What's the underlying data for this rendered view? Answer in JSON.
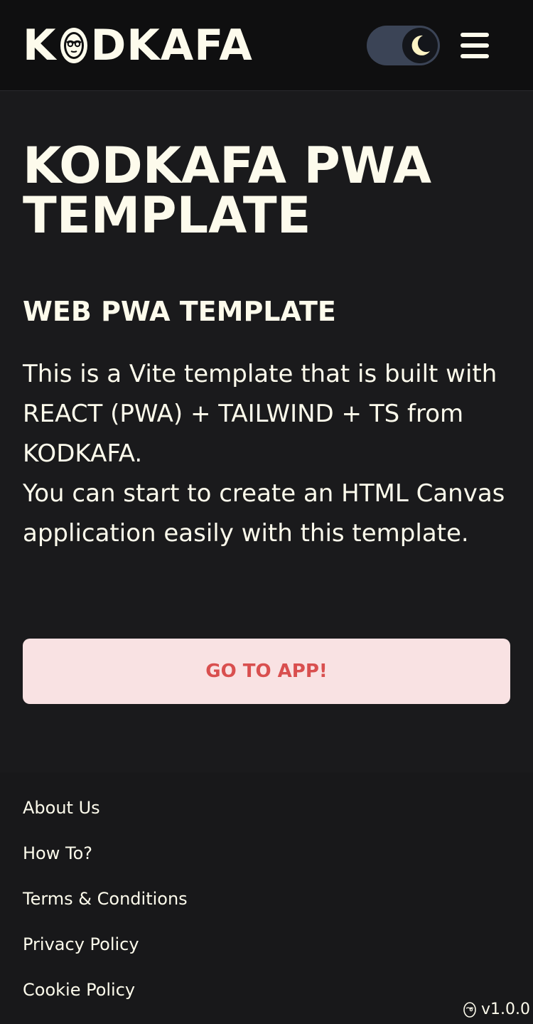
{
  "header": {
    "logo_text_left": "K",
    "logo_text_right": "DKAFA",
    "logo_alt": "KODKAFA",
    "theme_toggle": {
      "state": "dark",
      "icon": "moon-icon"
    },
    "menu_icon": "hamburger-menu-icon"
  },
  "main": {
    "title": "KODKAFA PWA TEMPLATE",
    "subtitle": "WEB PWA TEMPLATE",
    "description_line1": "This is a Vite template that is built with REACT (PWA) + TAILWIND + TS from KODKAFA.",
    "description_line2": "You can start to create an HTML Canvas application easily with this template.",
    "cta_label": "GO TO APP!"
  },
  "footer": {
    "links": [
      "About Us",
      "How To?",
      "Terms & Conditions",
      "Privacy Policy",
      "Cookie Policy"
    ],
    "version": "v1.0.0",
    "version_icon": "kodkafa-face-icon"
  },
  "colors": {
    "background": "#1a1a1c",
    "header_bg": "#0f0f10",
    "text": "#fdfbec",
    "toggle_track": "#3b4456",
    "cta_bg": "#f9e2e3",
    "cta_text": "#d94f4f"
  }
}
